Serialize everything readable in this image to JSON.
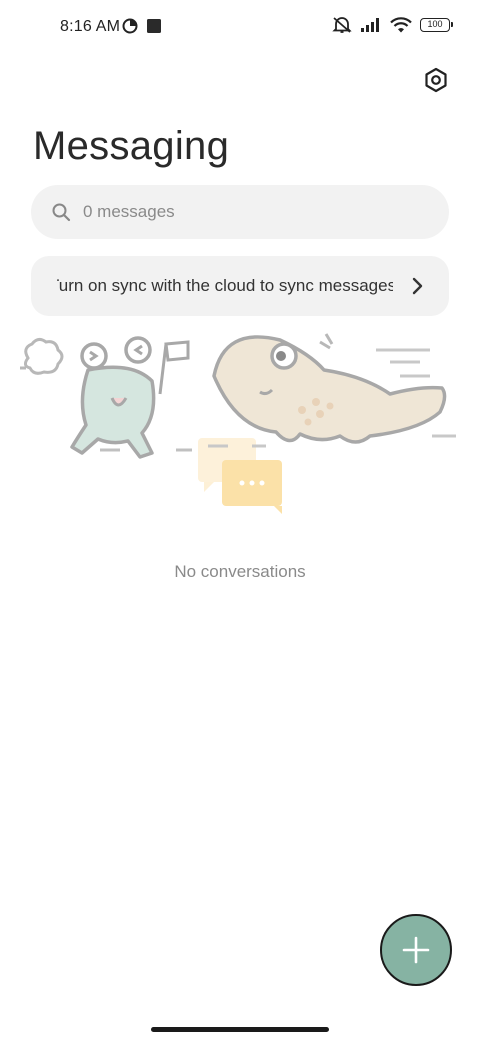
{
  "status_bar": {
    "time": "8:16 AM",
    "battery": "100",
    "icons": [
      "data-saver-icon",
      "stop-square-icon",
      "mute-icon",
      "signal-icon",
      "wifi-icon",
      "battery-icon"
    ]
  },
  "header": {
    "title": "Messaging",
    "settings_icon": "settings-hexagon-icon"
  },
  "search": {
    "placeholder": "0 messages",
    "icon": "search-icon"
  },
  "sync_banner": {
    "text": "Turn on sync with the cloud to sync messages",
    "icon": "chevron-right-icon"
  },
  "empty_state": {
    "text": "No conversations"
  },
  "fab": {
    "icon": "plus-icon",
    "color": "#86b3a3"
  },
  "colors": {
    "background": "#ffffff",
    "surface": "#f2f2f2",
    "accent": "#86b3a3"
  }
}
